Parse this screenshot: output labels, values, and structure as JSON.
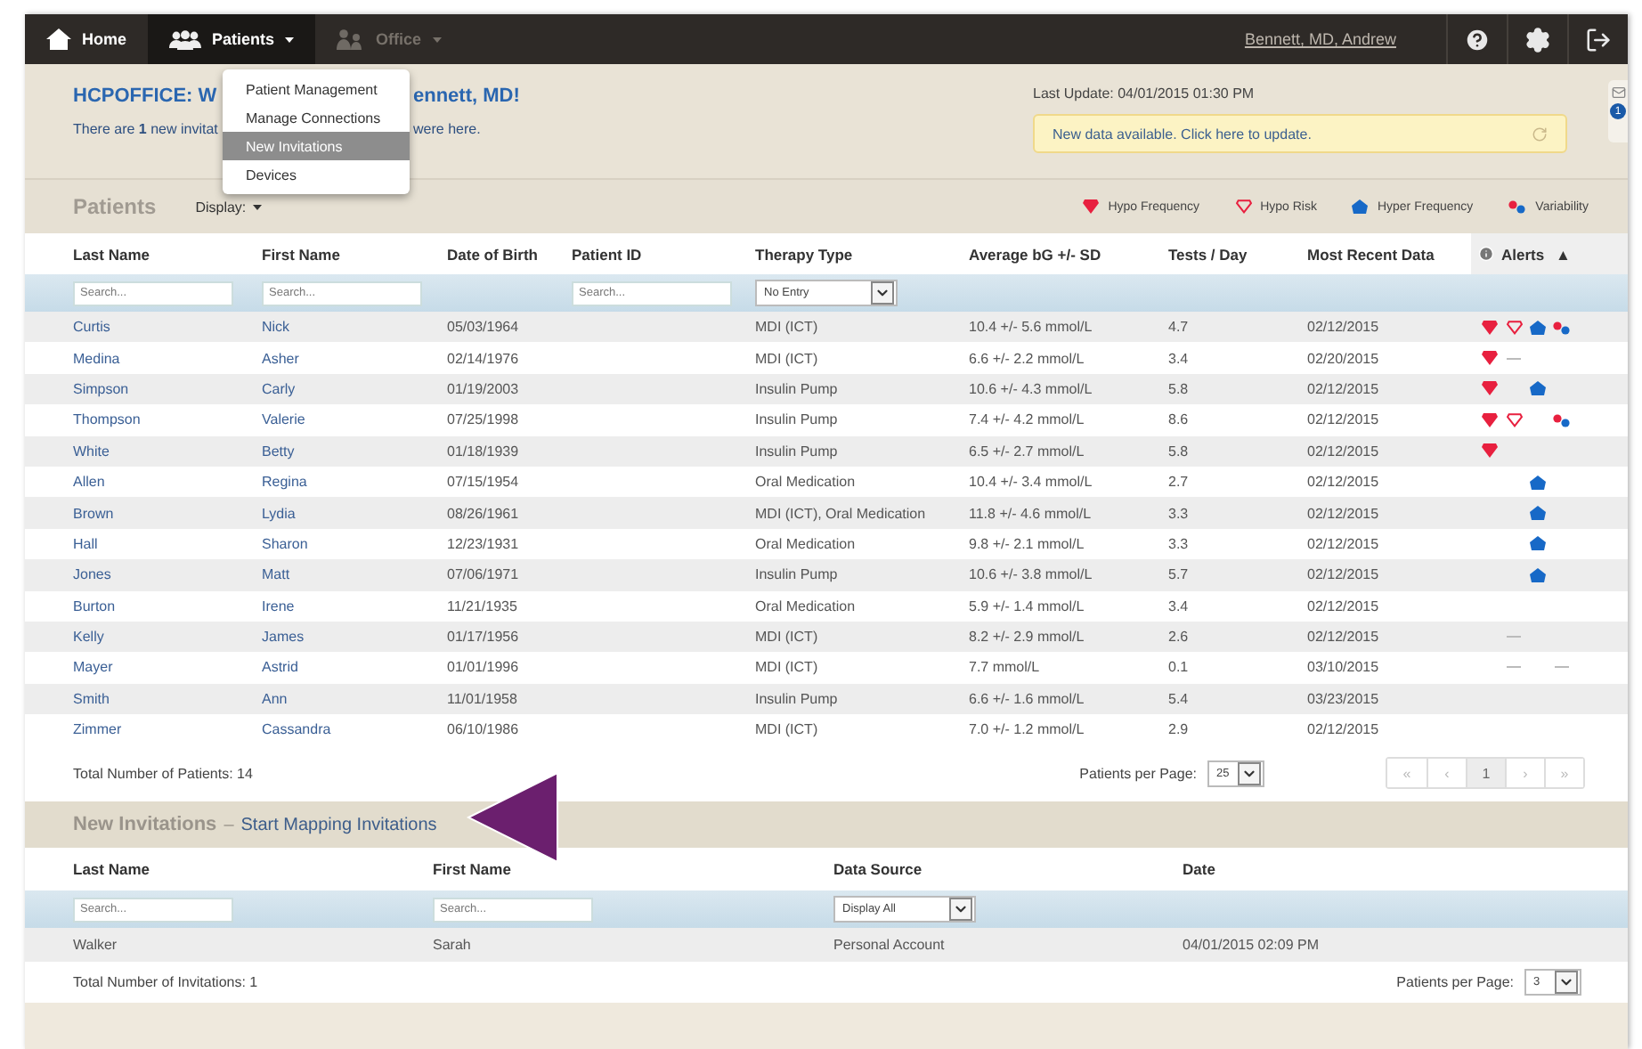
{
  "nav": {
    "items": [
      {
        "kind": "home",
        "label": "Home",
        "selected": false,
        "disabled": false,
        "caret": false
      },
      {
        "kind": "patients",
        "label": "Patients",
        "selected": true,
        "disabled": false,
        "caret": true
      },
      {
        "kind": "office",
        "label": "Office",
        "selected": false,
        "disabled": true,
        "caret": true
      }
    ],
    "user": "Bennett, MD, Andrew"
  },
  "menu": [
    {
      "label": "Patient Management",
      "selected": false
    },
    {
      "label": "Manage Connections",
      "selected": false
    },
    {
      "label": "New Invitations",
      "selected": true
    },
    {
      "label": "Devices",
      "selected": false
    }
  ],
  "welcome": {
    "title_parts": [
      "HCPOFFICE: W",
      "ennett, MD!"
    ],
    "message_parts": [
      "There are **1** new invitat",
      "were here."
    ]
  },
  "update": {
    "last_update": "Last Update: 04/01/2015 01:30 PM",
    "notice": "New data available. Click here to update."
  },
  "mail_badge": "1",
  "patients": {
    "title": "Patients",
    "display": "Display:",
    "legend": [
      {
        "kind": "hypo_frequency",
        "label": "Hypo Frequency"
      },
      {
        "kind": "hypo_risk",
        "label": "Hypo Risk"
      },
      {
        "kind": "hyper_frequency",
        "label": "Hyper Frequency"
      },
      {
        "kind": "variability",
        "label": "Variability"
      }
    ],
    "columns": [
      {
        "label": "Last Name",
        "filter": {
          "kind": "search",
          "placeholder": "Search..."
        }
      },
      {
        "label": "First Name",
        "filter": {
          "kind": "search",
          "placeholder": "Search..."
        }
      },
      {
        "label": "Date of Birth",
        "filter": {
          "kind": "none"
        }
      },
      {
        "label": "Patient ID",
        "filter": {
          "kind": "search",
          "placeholder": "Search..."
        }
      },
      {
        "label": "Therapy Type",
        "filter": {
          "kind": "select",
          "value": "No Entry"
        }
      },
      {
        "label": "Average bG +/- SD",
        "filter": {
          "kind": "none"
        }
      },
      {
        "label": "Tests / Day",
        "filter": {
          "kind": "none"
        }
      },
      {
        "label": "Most Recent Data",
        "filter": {
          "kind": "none"
        }
      },
      {
        "label": "Alerts",
        "sort": "▲",
        "info_icon": true,
        "filter": {
          "kind": "none"
        }
      }
    ],
    "rows": [
      {
        "last": "Curtis",
        "first": "Nick",
        "dob": "05/03/1964",
        "therapy": "MDI (ICT)",
        "avg": "10.4 +/- 5.6 mmol/L",
        "tests": "4.7",
        "recent": "02/12/2015",
        "alerts": [
          {
            "kind": "alert"
          },
          {
            "kind": "alert"
          },
          {
            "kind": "alert"
          },
          {
            "kind": "alert"
          }
        ]
      },
      {
        "last": "Medina",
        "first": "Asher",
        "dob": "02/14/1976",
        "therapy": "MDI (ICT)",
        "avg": "6.6 +/- 2.2 mmol/L",
        "tests": "3.4",
        "recent": "02/20/2015",
        "alerts": [
          {
            "kind": "alert"
          },
          {
            "kind": "no-data"
          },
          {
            "kind": "none"
          },
          {
            "kind": "none"
          }
        ]
      },
      {
        "last": "Simpson",
        "first": "Carly",
        "dob": "01/19/2003",
        "therapy": "Insulin Pump",
        "avg": "10.6 +/- 4.3 mmol/L",
        "tests": "5.8",
        "recent": "02/12/2015",
        "alerts": [
          {
            "kind": "alert"
          },
          {
            "kind": "none"
          },
          {
            "kind": "alert"
          },
          {
            "kind": "none"
          }
        ]
      },
      {
        "last": "Thompson",
        "first": "Valerie",
        "dob": "07/25/1998",
        "therapy": "Insulin Pump",
        "avg": "7.4 +/- 4.2 mmol/L",
        "tests": "8.6",
        "recent": "02/12/2015",
        "alerts": [
          {
            "kind": "alert"
          },
          {
            "kind": "alert"
          },
          {
            "kind": "none"
          },
          {
            "kind": "alert"
          }
        ]
      },
      {
        "last": "White",
        "first": "Betty",
        "dob": "01/18/1939",
        "therapy": "Insulin Pump",
        "avg": "6.5 +/- 2.7 mmol/L",
        "tests": "5.8",
        "recent": "02/12/2015",
        "alerts": [
          {
            "kind": "alert"
          },
          {
            "kind": "none"
          },
          {
            "kind": "none"
          },
          {
            "kind": "none"
          }
        ]
      },
      {
        "last": "Allen",
        "first": "Regina",
        "dob": "07/15/1954",
        "therapy": "Oral Medication",
        "avg": "10.4 +/- 3.4 mmol/L",
        "tests": "2.7",
        "recent": "02/12/2015",
        "alerts": [
          {
            "kind": "none"
          },
          {
            "kind": "none"
          },
          {
            "kind": "alert"
          },
          {
            "kind": "none"
          }
        ]
      },
      {
        "last": "Brown",
        "first": "Lydia",
        "dob": "08/26/1961",
        "therapy": "MDI (ICT), Oral Medication",
        "avg": "11.8 +/- 4.6 mmol/L",
        "tests": "3.3",
        "recent": "02/12/2015",
        "alerts": [
          {
            "kind": "none"
          },
          {
            "kind": "none"
          },
          {
            "kind": "alert"
          },
          {
            "kind": "none"
          }
        ]
      },
      {
        "last": "Hall",
        "first": "Sharon",
        "dob": "12/23/1931",
        "therapy": "Oral Medication",
        "avg": "9.8 +/- 2.1 mmol/L",
        "tests": "3.3",
        "recent": "02/12/2015",
        "alerts": [
          {
            "kind": "none"
          },
          {
            "kind": "none"
          },
          {
            "kind": "alert"
          },
          {
            "kind": "none"
          }
        ]
      },
      {
        "last": "Jones",
        "first": "Matt",
        "dob": "07/06/1971",
        "therapy": "Insulin Pump",
        "avg": "10.6 +/- 3.8 mmol/L",
        "tests": "5.7",
        "recent": "02/12/2015",
        "alerts": [
          {
            "kind": "none"
          },
          {
            "kind": "none"
          },
          {
            "kind": "alert"
          },
          {
            "kind": "none"
          }
        ]
      },
      {
        "last": "Burton",
        "first": "Irene",
        "dob": "11/21/1935",
        "therapy": "Oral Medication",
        "avg": "5.9 +/- 1.4 mmol/L",
        "tests": "3.4",
        "recent": "02/12/2015",
        "alerts": [
          {
            "kind": "none"
          },
          {
            "kind": "none"
          },
          {
            "kind": "none"
          },
          {
            "kind": "none"
          }
        ]
      },
      {
        "last": "Kelly",
        "first": "James",
        "dob": "01/17/1956",
        "therapy": "MDI (ICT)",
        "avg": "8.2 +/- 2.9 mmol/L",
        "tests": "2.6",
        "recent": "02/12/2015",
        "alerts": [
          {
            "kind": "none"
          },
          {
            "kind": "no-data"
          },
          {
            "kind": "none"
          },
          {
            "kind": "none"
          }
        ]
      },
      {
        "last": "Mayer",
        "first": "Astrid",
        "dob": "01/01/1996",
        "therapy": "MDI (ICT)",
        "avg": "7.7 mmol/L",
        "tests": "0.1",
        "recent": "03/10/2015",
        "alerts": [
          {
            "kind": "none"
          },
          {
            "kind": "no-data"
          },
          {
            "kind": "none"
          },
          {
            "kind": "no-data"
          }
        ]
      },
      {
        "last": "Smith",
        "first": "Ann",
        "dob": "11/01/1958",
        "therapy": "Insulin Pump",
        "avg": "6.6 +/- 1.6 mmol/L",
        "tests": "5.4",
        "recent": "03/23/2015",
        "alerts": [
          {
            "kind": "none"
          },
          {
            "kind": "none"
          },
          {
            "kind": "none"
          },
          {
            "kind": "none"
          }
        ]
      },
      {
        "last": "Zimmer",
        "first": "Cassandra",
        "dob": "06/10/1986",
        "therapy": "MDI (ICT)",
        "avg": "7.0 +/- 1.2 mmol/L",
        "tests": "2.9",
        "recent": "02/12/2015",
        "alerts": [
          {
            "kind": "none"
          },
          {
            "kind": "none"
          },
          {
            "kind": "none"
          },
          {
            "kind": "none"
          }
        ]
      }
    ],
    "total": "Total Number of Patients: 14",
    "per_page_label": "Patients per Page:",
    "per_page": "25",
    "pages": [
      {
        "label": "«",
        "selected": false
      },
      {
        "label": "‹",
        "selected": false
      },
      {
        "label": "1",
        "selected": true
      },
      {
        "label": "›",
        "selected": false
      },
      {
        "label": "»",
        "selected": false
      }
    ]
  },
  "invitations": {
    "title": "New Invitations",
    "separator": "–",
    "link": "Start Mapping Invitations",
    "columns": [
      {
        "label": "Last Name",
        "filter": {
          "kind": "search",
          "placeholder": "Search..."
        }
      },
      {
        "label": "First Name",
        "filter": {
          "kind": "search",
          "placeholder": "Search..."
        }
      },
      {
        "label": "Data Source",
        "filter": {
          "kind": "select",
          "value": "Display All"
        }
      },
      {
        "label": "Date",
        "filter": {
          "kind": "none"
        }
      }
    ],
    "rows": [
      {
        "last": "Walker",
        "first": "Sarah",
        "source": "Personal Account",
        "date": "04/01/2015 02:09 PM"
      }
    ],
    "total": "Total Number of Invitations: 1",
    "per_page_label": "Patients per Page:",
    "per_page": "3"
  }
}
